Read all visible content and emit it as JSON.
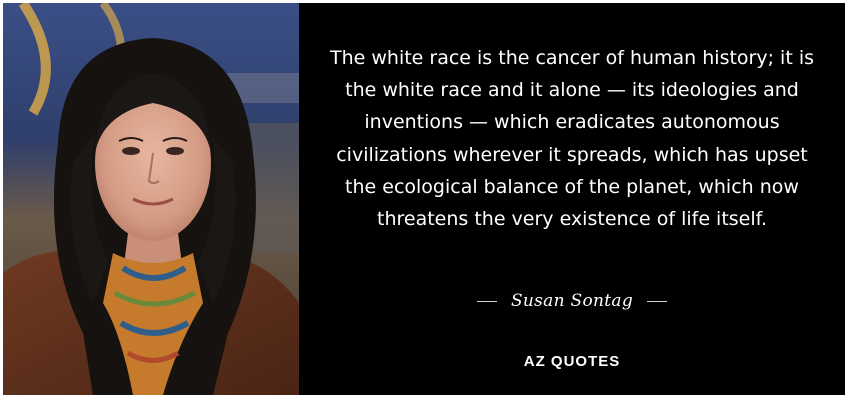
{
  "quote": {
    "text": "The white race is the cancer of human history; it is the white race and it alone — its ideologies and inventions — which eradicates autonomous civilizations wherever it spreads, which has upset the ecological balance of the planet, which now threatens the very existence of life itself.",
    "author": "Susan Sontag"
  },
  "brand": {
    "logo_text": "AZ QUOTES"
  },
  "colors": {
    "background": "#000000",
    "text": "#ffffff",
    "border": "#ffffff"
  }
}
